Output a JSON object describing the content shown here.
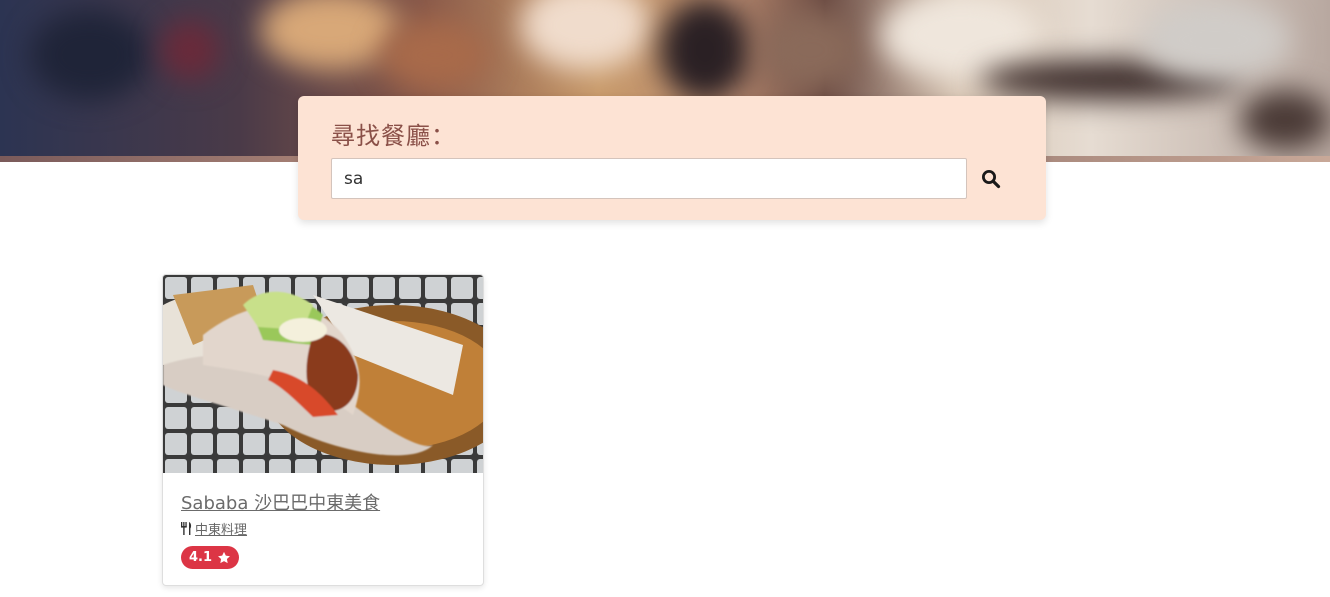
{
  "colors": {
    "search_card_bg": "#fde3d4",
    "search_title": "#8a5048",
    "rating_badge_bg": "#dc3545",
    "card_title": "#6b6b6b"
  },
  "search": {
    "title": "尋找餐廳：",
    "value": "sa",
    "button_icon": "search-icon"
  },
  "results": [
    {
      "name": "Sababa 沙巴巴中東美食",
      "category": "中東料理",
      "category_icon": "utensils-icon",
      "rating": "4.1",
      "rating_icon": "star-icon",
      "image": "falafel-pita-photo"
    }
  ]
}
